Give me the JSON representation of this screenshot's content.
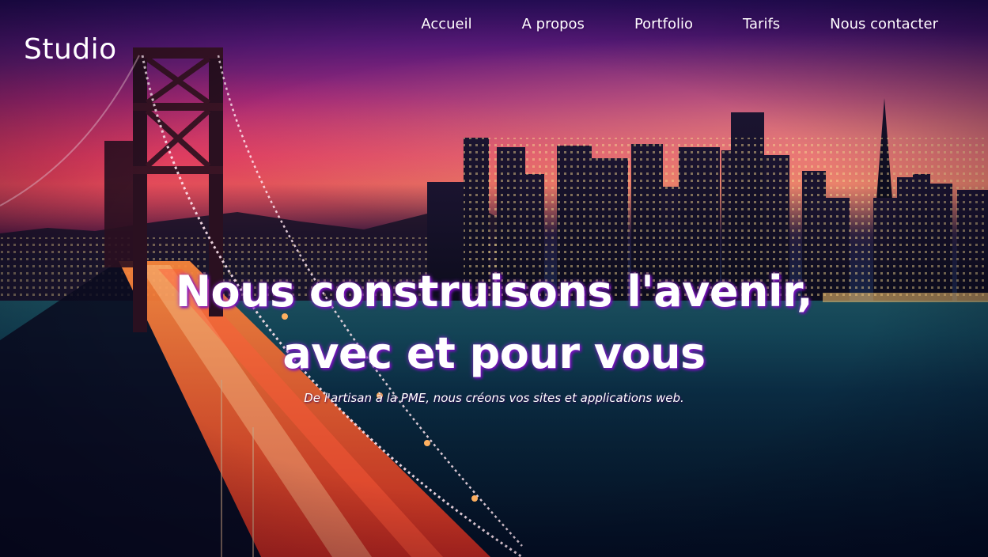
{
  "brand": {
    "name": "Studio"
  },
  "nav": {
    "items": [
      {
        "label": "Accueil"
      },
      {
        "label": "A propos"
      },
      {
        "label": "Portfolio"
      },
      {
        "label": "Tarifs"
      },
      {
        "label": "Nous contacter"
      }
    ]
  },
  "hero": {
    "headline_line1": "Nous construisons l'avenir,",
    "headline_line2": "avec et pour vous",
    "subheadline": "De l'artisan à la PME, nous créons vos sites et applications web."
  },
  "colors": {
    "sky_top": "#2a0e5e",
    "sky_magenta": "#9a2a7a",
    "sky_horizon": "#e07060",
    "water": "#0f2a4a",
    "text": "#ffffff",
    "text_glow": "#9628dc"
  }
}
